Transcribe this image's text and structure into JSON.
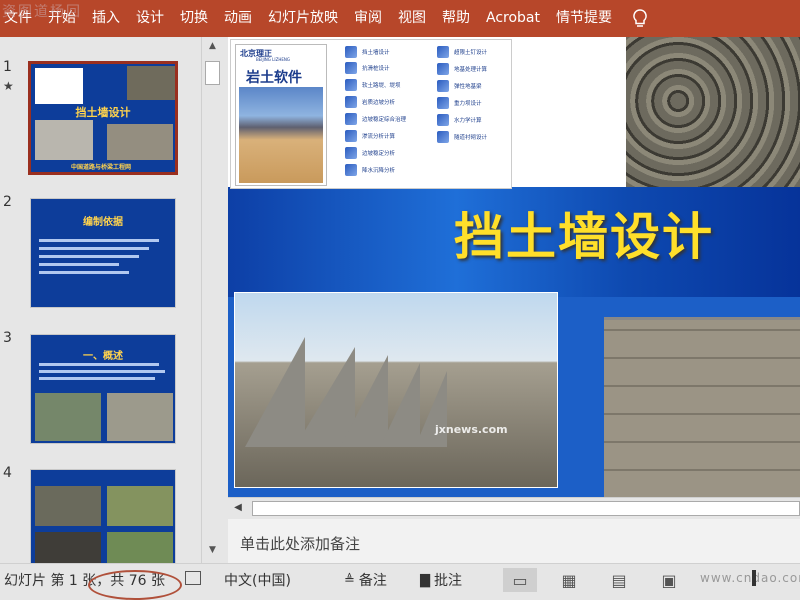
{
  "watermark_top": "资图道杨回",
  "ribbon": {
    "tabs": [
      "文件",
      "开始",
      "插入",
      "设计",
      "切换",
      "动画",
      "幻灯片放映",
      "审阅",
      "视图",
      "帮助",
      "Acrobat",
      "情节提要"
    ],
    "icon": "lightbulb-icon"
  },
  "thumbnails": [
    {
      "num": "1",
      "title": "挡土墙设计",
      "footer": "中国道路与桥梁工程网"
    },
    {
      "num": "2",
      "title": "编制依据"
    },
    {
      "num": "3",
      "title": "一、概述"
    },
    {
      "num": "4"
    }
  ],
  "slide": {
    "title": "挡土墙设计",
    "photo_watermark": "jxnews.com",
    "cover": {
      "logo": "北京理正",
      "logo_sub": "BEIJING LIZHENG",
      "name": "岩土软件"
    },
    "features_col1": [
      "挡土墙设计",
      "抗滑桩设计",
      "软土路堤、堤坝",
      "岩质边坡分析",
      "边坡稳定综合治理",
      "渗流分析计算",
      "边坡稳定分析",
      "降水沉降分析"
    ],
    "features_col2": [
      "超限土钉设计",
      "地基处理计算",
      "弹性地基梁",
      "重力坝设计",
      "水力学计算",
      "隧道衬砌设计"
    ]
  },
  "notes_placeholder": "单击此处添加备注",
  "status": {
    "slide_count": "幻灯片 第 1 张，共 76 张",
    "language": "中文(中国)",
    "notes_label": "备注",
    "comments_label": "批注",
    "watermark": "www.cndao.com"
  },
  "colors": {
    "ribbon": "#b7472a",
    "slide_blue": "#1c5fc7",
    "title_yellow": "#ffdf2a",
    "annotation_oval": "#b0503a"
  }
}
